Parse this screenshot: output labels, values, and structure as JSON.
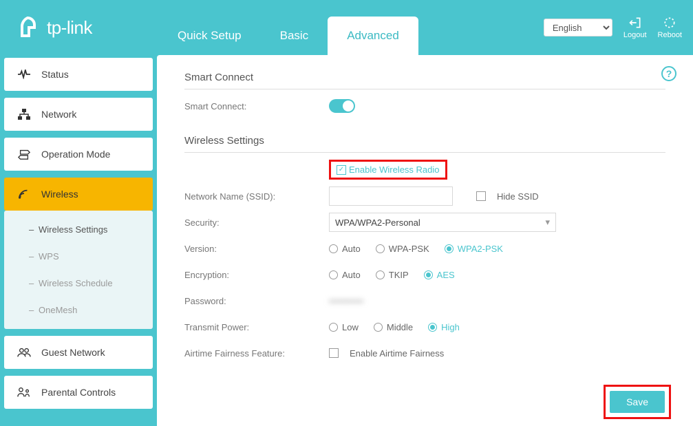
{
  "brand": "tp-link",
  "tabs": {
    "quick": "Quick Setup",
    "basic": "Basic",
    "advanced": "Advanced"
  },
  "lang": "English",
  "top_actions": {
    "logout": "Logout",
    "reboot": "Reboot"
  },
  "sidebar": {
    "status": "Status",
    "network": "Network",
    "operation": "Operation Mode",
    "wireless": "Wireless",
    "guest": "Guest Network",
    "parental": "Parental Controls"
  },
  "wireless_sub": {
    "settings": "Wireless Settings",
    "wps": "WPS",
    "schedule": "Wireless Schedule",
    "onemesh": "OneMesh"
  },
  "section1": "Smart Connect",
  "smart_connect_label": "Smart Connect:",
  "section2": "Wireless Settings",
  "enable_radio": "Enable Wireless Radio",
  "ssid_label": "Network Name (SSID):",
  "ssid_value": "",
  "hide_ssid": "Hide SSID",
  "security_label": "Security:",
  "security_value": "WPA/WPA2-Personal",
  "version_label": "Version:",
  "version_opts": {
    "auto": "Auto",
    "wpa": "WPA-PSK",
    "wpa2": "WPA2-PSK"
  },
  "encryption_label": "Encryption:",
  "encryption_opts": {
    "auto": "Auto",
    "tkip": "TKIP",
    "aes": "AES"
  },
  "password_label": "Password:",
  "password_value": "•••••••••••",
  "transmit_label": "Transmit Power:",
  "transmit_opts": {
    "low": "Low",
    "middle": "Middle",
    "high": "High"
  },
  "airtime_label": "Airtime Fairness Feature:",
  "airtime_check": "Enable Airtime Fairness",
  "save": "Save"
}
